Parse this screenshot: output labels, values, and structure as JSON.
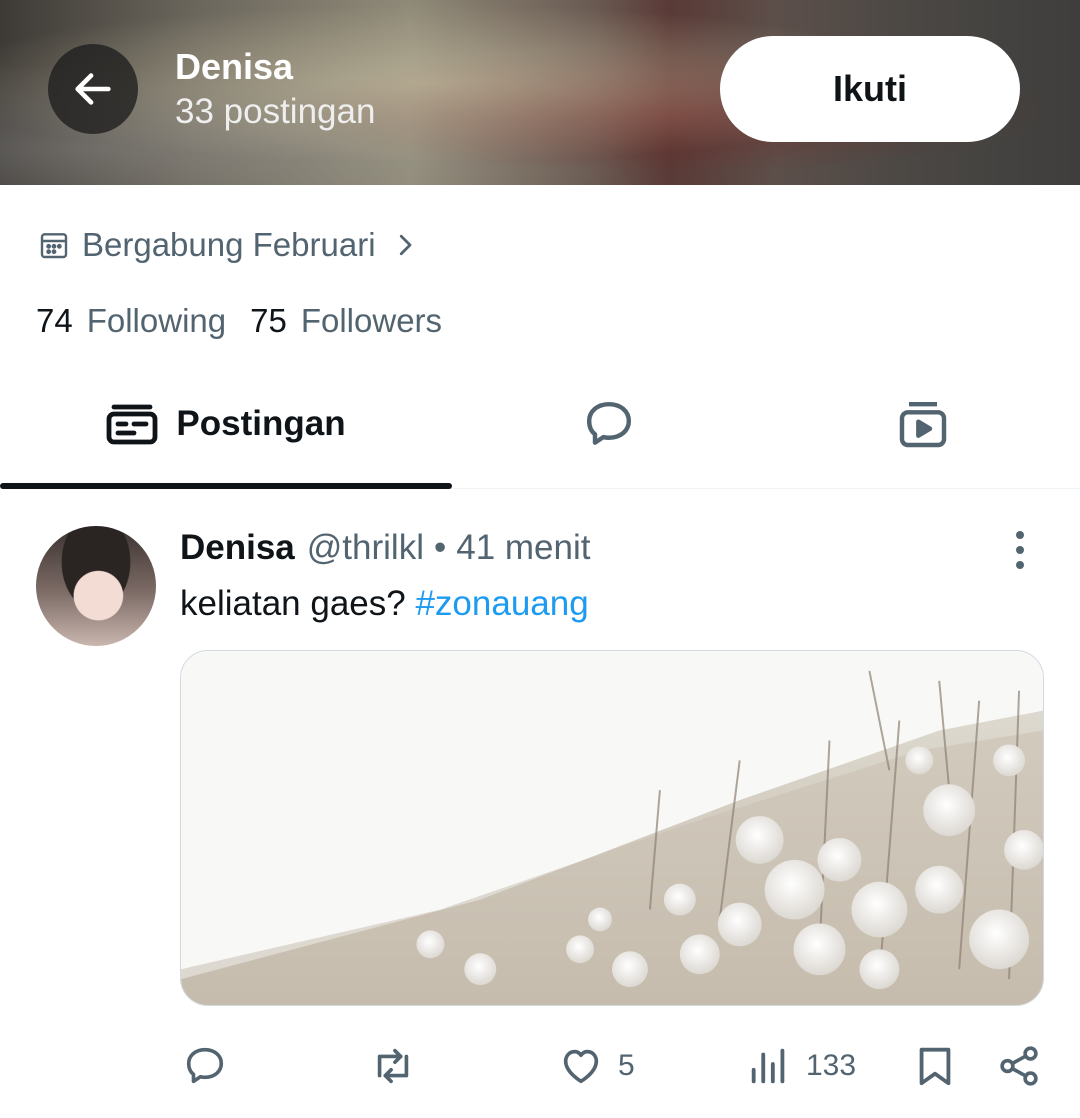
{
  "header": {
    "name": "Denisa",
    "post_count": "33 postingan",
    "follow_label": "Ikuti"
  },
  "profile": {
    "joined": "Bergabung Februari",
    "following_count": "74",
    "following_label": "Following",
    "followers_count": "75",
    "followers_label": "Followers"
  },
  "tabs": {
    "posts_label": "Postingan"
  },
  "post": {
    "name": "Denisa",
    "handle": "@thrilkl",
    "separator": "•",
    "time": "41 menit",
    "text": "keliatan gaes?",
    "hashtag": "#zonauang",
    "likes": "5",
    "views": "133"
  },
  "icons": [
    "back-arrow-icon",
    "calendar-icon",
    "chevron-right-icon",
    "posts-icon",
    "replies-icon",
    "media-icon",
    "more-vertical-icon",
    "reply-icon",
    "repost-icon",
    "like-icon",
    "views-icon",
    "bookmark-icon",
    "share-icon"
  ],
  "colors": {
    "link": "#1d9bf0",
    "secondary_text": "#536471",
    "primary_text": "#0f1419"
  }
}
